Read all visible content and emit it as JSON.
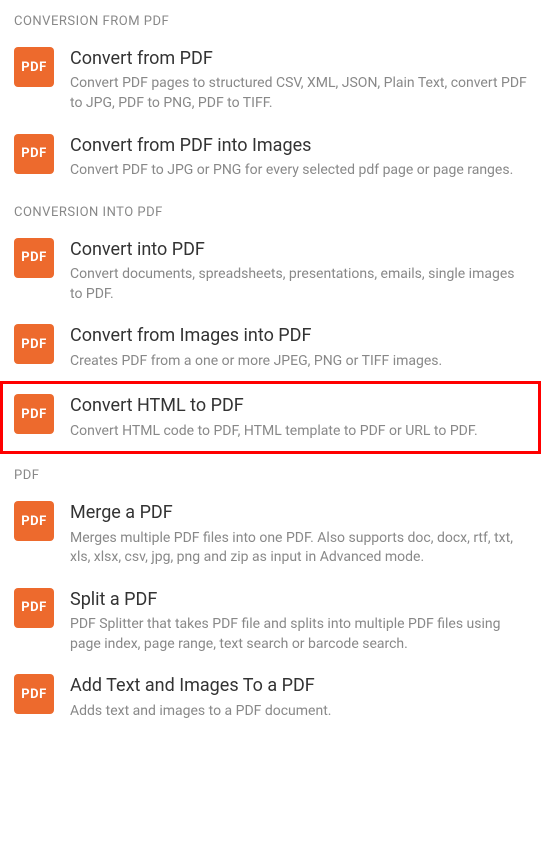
{
  "icon_label": "PDF",
  "sections": [
    {
      "header": "CONVERSION FROM PDF",
      "items": [
        {
          "title": "Convert from PDF",
          "desc": "Convert PDF pages to structured CSV, XML, JSON, Plain Text, convert PDF to JPG, PDF to PNG, PDF to TIFF.",
          "highlighted": false
        },
        {
          "title": "Convert from PDF into Images",
          "desc": "Convert PDF to JPG or PNG for every selected pdf page or page ranges.",
          "highlighted": false
        }
      ]
    },
    {
      "header": "CONVERSION INTO PDF",
      "items": [
        {
          "title": "Convert into PDF",
          "desc": "Convert documents, spreadsheets, presentations, emails, single images to PDF.",
          "highlighted": false
        },
        {
          "title": "Convert from Images into PDF",
          "desc": "Creates PDF from a one or more JPEG, PNG or TIFF images.",
          "highlighted": false
        },
        {
          "title": "Convert HTML to PDF",
          "desc": "Convert HTML code to PDF, HTML template to PDF or URL to PDF.",
          "highlighted": true
        }
      ]
    },
    {
      "header": "PDF",
      "items": [
        {
          "title": "Merge a PDF",
          "desc": "Merges multiple PDF files into one PDF. Also supports doc, docx, rtf, txt, xls, xlsx, csv, jpg, png and zip as input in Advanced mode.",
          "highlighted": false
        },
        {
          "title": "Split a PDF",
          "desc": "PDF Splitter that takes PDF file and splits into multiple PDF files using page index, page range, text search or barcode search.",
          "highlighted": false
        },
        {
          "title": "Add Text and Images To a PDF",
          "desc": "Adds text and images to a PDF document.",
          "highlighted": false
        }
      ]
    }
  ]
}
